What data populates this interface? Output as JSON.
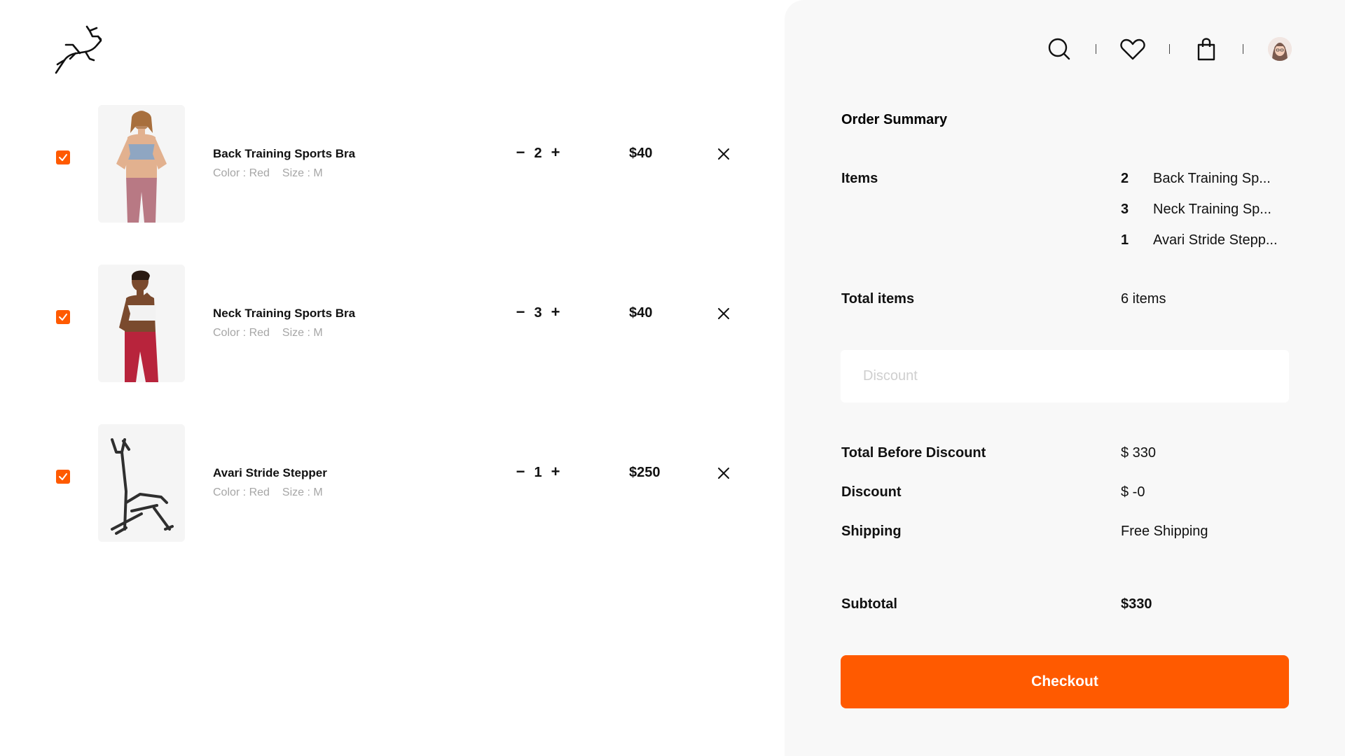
{
  "brand": {
    "logo_icon": "gazelle-logo-icon"
  },
  "header": {
    "icons": [
      "search-icon",
      "heart-icon",
      "bag-icon",
      "avatar"
    ]
  },
  "colors": {
    "accent": "#ff5a00",
    "panel": "#f8f8f8",
    "muted": "#a6a6a6"
  },
  "cart": {
    "items": [
      {
        "name": "Back Training Sports Bra",
        "color": "Color : Red",
        "size": "Size : M",
        "qty": "2",
        "price": "$40",
        "checked": true,
        "image": "sports-bra-blue-image"
      },
      {
        "name": "Neck Training Sports Bra",
        "color": "Color : Red",
        "size": "Size : M",
        "qty": "3",
        "price": "$40",
        "checked": true,
        "image": "sports-bra-white-image"
      },
      {
        "name": "Avari Stride Stepper",
        "color": "Color : Red",
        "size": "Size : M",
        "qty": "1",
        "price": "$250",
        "checked": true,
        "image": "stepper-image"
      }
    ],
    "minus": "−",
    "plus": "+"
  },
  "summary": {
    "title": "Order Summary",
    "items_label": "Items",
    "items": [
      {
        "count": "2",
        "name": "Back Training Sp..."
      },
      {
        "count": "3",
        "name": "Neck Training Sp..."
      },
      {
        "count": "1",
        "name": "Avari Stride Stepp..."
      }
    ],
    "total_items_label": "Total items",
    "total_items_value": "6 items",
    "discount_placeholder": "Discount",
    "total_before_label": "Total Before Discount",
    "total_before_value": "$ 330",
    "discount_label": "Discount",
    "discount_value": "$ -0",
    "shipping_label": "Shipping",
    "shipping_value": "Free Shipping",
    "subtotal_label": "Subtotal",
    "subtotal_value": "$330",
    "checkout_label": "Checkout"
  }
}
